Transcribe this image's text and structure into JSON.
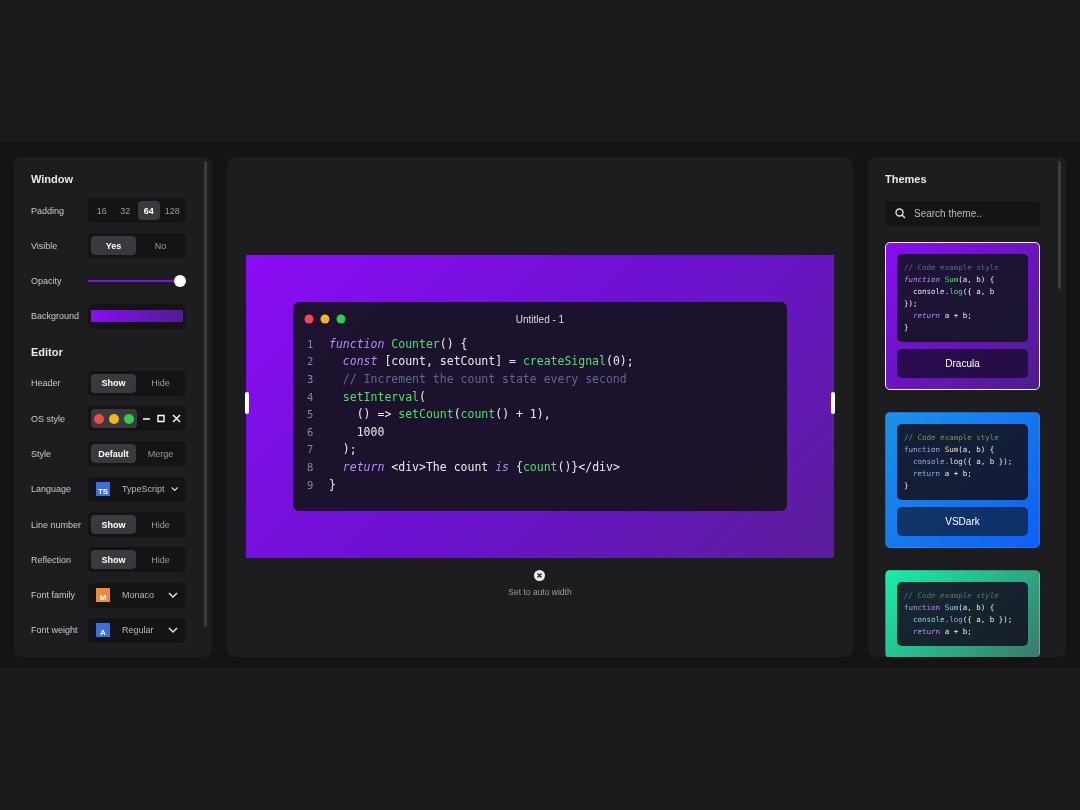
{
  "settings": {
    "sections": [
      {
        "title": "Window",
        "rows": [
          {
            "kind": "segmented",
            "label": "Padding",
            "options": [
              {
                "label": "16",
                "selected": false
              },
              {
                "label": "32",
                "selected": false
              },
              {
                "label": "64",
                "selected": true
              },
              {
                "label": "128",
                "selected": false
              }
            ]
          },
          {
            "kind": "segmented",
            "label": "Visible",
            "options": [
              {
                "label": "Yes",
                "selected": true
              },
              {
                "label": "No",
                "selected": false
              }
            ]
          },
          {
            "kind": "slider",
            "label": "Opacity",
            "level": 1
          },
          {
            "kind": "gradient",
            "label": "Background"
          }
        ]
      },
      {
        "title": "Editor",
        "rows": [
          {
            "kind": "segmented",
            "label": "Header",
            "options": [
              {
                "label": "Show",
                "selected": true
              },
              {
                "label": "Hide",
                "selected": false
              }
            ]
          },
          {
            "kind": "os",
            "label": "OS style",
            "options": [
              {
                "kind": "mac",
                "selected": true
              },
              {
                "kind": "windows",
                "selected": false
              }
            ]
          },
          {
            "kind": "segmented",
            "label": "Style",
            "options": [
              {
                "label": "Default",
                "selected": true
              },
              {
                "label": "Merge",
                "selected": false
              }
            ]
          },
          {
            "kind": "select",
            "label": "Language",
            "badge": "TS",
            "color": "#3b6fe0",
            "value": "TypeScript"
          },
          {
            "kind": "segmented",
            "label": "Line number",
            "options": [
              {
                "label": "Show",
                "selected": true
              },
              {
                "label": "Hide",
                "selected": false
              }
            ]
          },
          {
            "kind": "segmented",
            "label": "Reflection",
            "options": [
              {
                "label": "Show",
                "selected": true
              },
              {
                "label": "Hide",
                "selected": false
              }
            ]
          },
          {
            "kind": "select",
            "label": "Font family",
            "badge": "M",
            "color": "#f08a3c",
            "value": "Monaco"
          },
          {
            "kind": "select",
            "label": "Font weight",
            "badge": "A",
            "color": "#3b6fe0",
            "value": "Regular"
          }
        ]
      }
    ]
  },
  "editor": {
    "title": "Untitled - 1",
    "lines": [
      {
        "number": "1",
        "tokens": [
          {
            "kind": "kw",
            "text": "function"
          },
          {
            "kind": "fn",
            "text": " Counter"
          },
          {
            "kind": "tx",
            "text": "() {"
          }
        ]
      },
      {
        "number": "2",
        "tokens": [
          {
            "kind": "kw",
            "text": "  const"
          },
          {
            "kind": "tx",
            "text": " [count, setCount] = "
          },
          {
            "kind": "fn",
            "text": "createSignal"
          },
          {
            "kind": "tx",
            "text": "(0);"
          }
        ]
      },
      {
        "number": "3",
        "tokens": [
          {
            "kind": "cm",
            "text": "  // Increment the count state every second"
          }
        ]
      },
      {
        "number": "4",
        "tokens": [
          {
            "kind": "fn",
            "text": "  setInterval"
          },
          {
            "kind": "tx",
            "text": "("
          }
        ]
      },
      {
        "number": "5",
        "tokens": [
          {
            "kind": "tx",
            "text": "    () => "
          },
          {
            "kind": "fn",
            "text": "setCount"
          },
          {
            "kind": "tx",
            "text": "("
          },
          {
            "kind": "fn",
            "text": "count"
          },
          {
            "kind": "tx",
            "text": "() + 1),"
          }
        ]
      },
      {
        "number": "6",
        "tokens": [
          {
            "kind": "tx",
            "text": "    1000"
          }
        ]
      },
      {
        "number": "7",
        "tokens": [
          {
            "kind": "tx",
            "text": "  );"
          }
        ]
      },
      {
        "number": "8",
        "tokens": [
          {
            "kind": "kw",
            "text": "  return"
          },
          {
            "kind": "tx",
            "text": " <div>The count "
          },
          {
            "kind": "kw",
            "text": "is"
          },
          {
            "kind": "tx",
            "text": " {"
          },
          {
            "kind": "fn",
            "text": "count"
          },
          {
            "kind": "tx",
            "text": "()}</div>"
          }
        ]
      },
      {
        "number": "9",
        "tokens": [
          {
            "kind": "tx",
            "text": "}"
          }
        ]
      }
    ]
  },
  "auto_width": {
    "label": "Set to auto width"
  },
  "themes": {
    "title": "Themes",
    "search": {
      "placeholder": "Search theme.."
    },
    "items": [
      {
        "kind": "dracula",
        "name": "Dracula",
        "selected": true,
        "lines": [
          [
            {
              "kind": "cm",
              "text": "// Code example style"
            }
          ],
          [
            {
              "kind": "kw",
              "text": "function"
            },
            {
              "kind": "fn",
              "text": " Sum"
            },
            {
              "kind": "tx",
              "text": "(a, b) {"
            }
          ],
          [
            {
              "kind": "tx",
              "text": "  console."
            },
            {
              "kind": "fn",
              "text": "log"
            },
            {
              "kind": "tx",
              "text": "({ a, b"
            }
          ],
          [
            {
              "kind": "tx",
              "text": "});"
            }
          ],
          [
            {
              "kind": "kw",
              "text": "  return"
            },
            {
              "kind": "tx",
              "text": " a + b;"
            }
          ],
          [
            {
              "kind": "tx",
              "text": "}"
            }
          ]
        ]
      },
      {
        "kind": "vsdark",
        "name": "VSDark",
        "selected": false,
        "lines": [
          [
            {
              "kind": "cm",
              "text": "// Code example style"
            }
          ],
          [
            {
              "kind": "kw",
              "text": "function"
            },
            {
              "kind": "fn",
              "text": " Sum"
            },
            {
              "kind": "tx",
              "text": "(a, b) {"
            }
          ],
          [
            {
              "kind": "kw",
              "text": "  console."
            },
            {
              "kind": "fn",
              "text": "log"
            },
            {
              "kind": "tx",
              "text": "({ a, b });"
            }
          ],
          [
            {
              "kind": "kw",
              "text": "  return"
            },
            {
              "kind": "tx",
              "text": " a + b;"
            }
          ],
          [
            {
              "kind": "tx",
              "text": "}"
            }
          ]
        ]
      },
      {
        "kind": "material",
        "selected": false,
        "lines": [
          [
            {
              "kind": "cm",
              "text": "// Code example style"
            }
          ],
          [
            {
              "kind": "kw",
              "text": "function"
            },
            {
              "kind": "fn",
              "text": " Sum"
            },
            {
              "kind": "tx",
              "text": "(a, b) {"
            }
          ],
          [
            {
              "kind": "fn",
              "text": "  console."
            },
            {
              "kind": "kw",
              "text": "log"
            },
            {
              "kind": "tx",
              "text": "({ a, b });"
            }
          ],
          [
            {
              "kind": "kw",
              "text": "  return"
            },
            {
              "kind": "tx",
              "text": " a + b;"
            }
          ]
        ]
      }
    ]
  }
}
